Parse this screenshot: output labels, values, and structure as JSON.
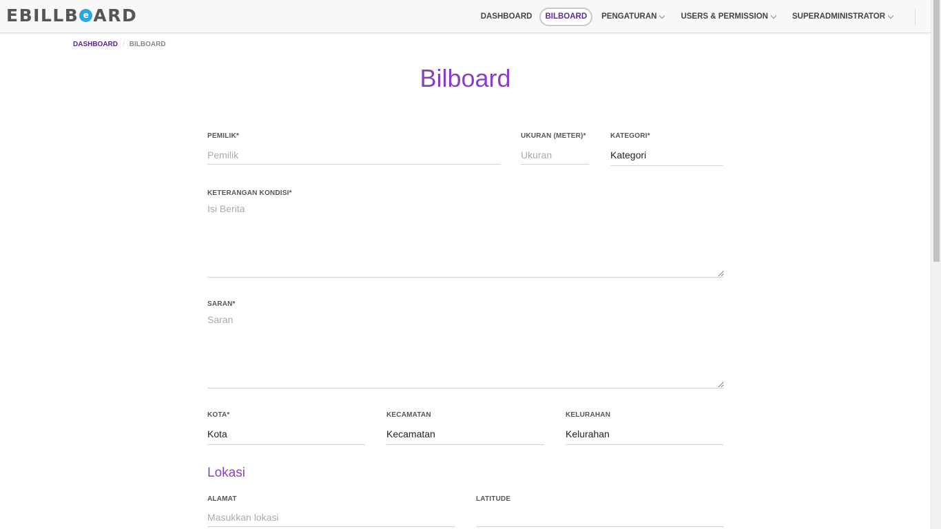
{
  "brand": {
    "logo_text_pre": "EBILLB",
    "logo_o": "e",
    "logo_text_post": "ARD"
  },
  "nav": {
    "dashboard": "DASHBOARD",
    "bilboard": "BILBOARD",
    "pengaturan": "PENGATURAN",
    "users": "USERS & PERMISSION",
    "superadmin": "SUPERADMINISTRATOR"
  },
  "breadcrumb": {
    "home": "DASHBOARD",
    "separator": "/",
    "current": "BILBOARD"
  },
  "page": {
    "title": "Bilboard"
  },
  "form": {
    "pemilik": {
      "label": "PEMILIK*",
      "placeholder": "Pemilik",
      "value": ""
    },
    "ukuran": {
      "label": "UKURAN (METER)*",
      "placeholder": "Ukuran",
      "value": ""
    },
    "kategori": {
      "label": "KATEGORI*",
      "selected": "Kategori"
    },
    "keterangan": {
      "label": "KETERANGAN KONDISI*",
      "placeholder": "Isi Berita",
      "value": ""
    },
    "saran": {
      "label": "SARAN*",
      "placeholder": "Saran",
      "value": ""
    },
    "kota": {
      "label": "KOTA*",
      "selected": "Kota"
    },
    "kecamatan": {
      "label": "KECAMATAN",
      "selected": "Kecamatan"
    },
    "kelurahan": {
      "label": "KELURAHAN",
      "selected": "Kelurahan"
    },
    "lokasi_section": "Lokasi",
    "alamat": {
      "label": "ALAMAT",
      "placeholder": "Masukkan lokasi",
      "value": ""
    },
    "latitude": {
      "label": "LATITUDE",
      "placeholder": "",
      "value": ""
    }
  },
  "colors": {
    "accent": "#8a3fc7",
    "link": "#5a1f9e",
    "logo_circle": "#29a9e0"
  }
}
